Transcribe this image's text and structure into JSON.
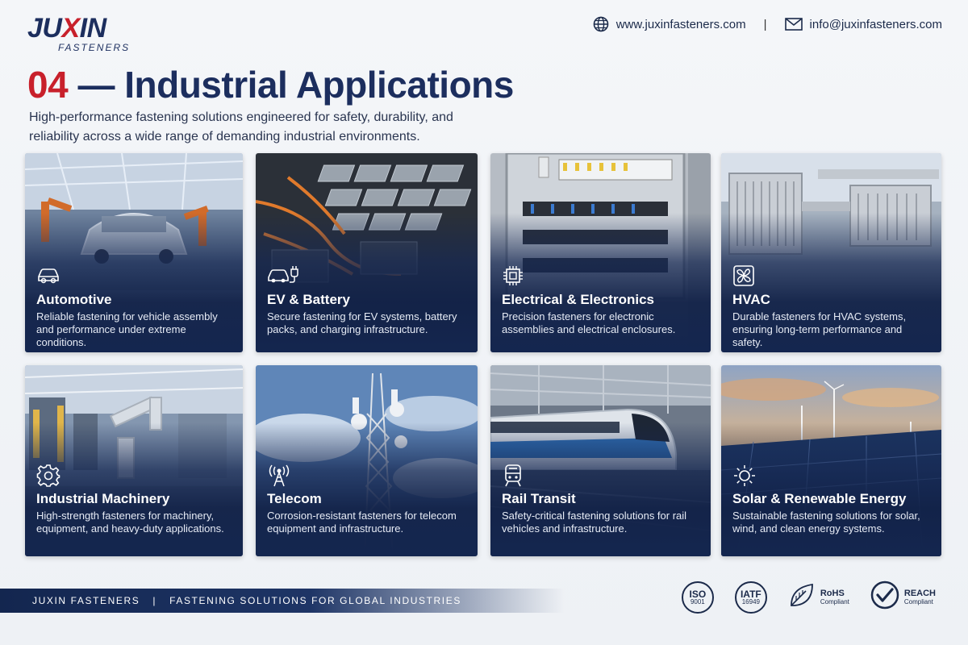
{
  "brand": {
    "logo_main_a": "JU",
    "logo_main_x": "X",
    "logo_main_b": "IN",
    "logo_sub": "FASTENERS"
  },
  "contact": {
    "website": "www.juxinfasteners.com",
    "separator": "|",
    "email": "info@juxinfasteners.com",
    "website_icon": "globe-icon",
    "email_icon": "mail-icon"
  },
  "header": {
    "number": "04",
    "title": " — Industrial Applications",
    "subtitle": "High-performance fastening solutions engineered for safety, durability, and reliability across a wide range of demanding industrial environments."
  },
  "cards": [
    {
      "title": "Automotive",
      "desc": "Reliable fastening for vehicle assembly and performance under extreme conditions.",
      "icon": "car-icon",
      "scene": "automotive"
    },
    {
      "title": "EV & Battery",
      "desc": "Secure fastening for EV systems, battery packs, and charging infrastructure.",
      "icon": "ev-plug-icon",
      "scene": "battery"
    },
    {
      "title": "Electrical & Electronics",
      "desc": "Precision fasteners for electronic assemblies and electrical enclosures.",
      "icon": "chip-icon",
      "scene": "electrical"
    },
    {
      "title": "HVAC",
      "desc": "Durable fasteners for HVAC systems, ensuring long-term performance and safety.",
      "icon": "fan-icon",
      "scene": "hvac"
    },
    {
      "title": "Industrial Machinery",
      "desc": "High-strength fasteners for machinery, equipment, and heavy-duty applications.",
      "icon": "gear-icon",
      "scene": "machinery"
    },
    {
      "title": "Telecom",
      "desc": "Corrosion-resistant fasteners for telecom equipment and infrastructure.",
      "icon": "antenna-icon",
      "scene": "telecom"
    },
    {
      "title": "Rail Transit",
      "desc": "Safety-critical fastening solutions for rail vehicles and infrastructure.",
      "icon": "train-icon",
      "scene": "rail"
    },
    {
      "title": "Solar & Renewable Energy",
      "desc": "Sustainable fastening solutions for solar, wind, and clean energy systems.",
      "icon": "sun-icon",
      "scene": "solar"
    }
  ],
  "footer": {
    "company": "JUXIN FASTENERS",
    "separator": "|",
    "tagline": "FASTENING SOLUTIONS FOR GLOBAL INDUSTRIES"
  },
  "certifications": [
    {
      "big": "ISO",
      "small": "9001"
    },
    {
      "big": "IATF",
      "small": "16949"
    },
    {
      "label": "RoHS",
      "sub": "Compliant",
      "icon": "leaf-icon"
    },
    {
      "label": "REACH",
      "sub": "Compliant",
      "icon": "check-circle-icon"
    }
  ],
  "colors": {
    "navy": "#1c2e5e",
    "accent_red": "#c8202b",
    "card_shade": "#14264f"
  }
}
